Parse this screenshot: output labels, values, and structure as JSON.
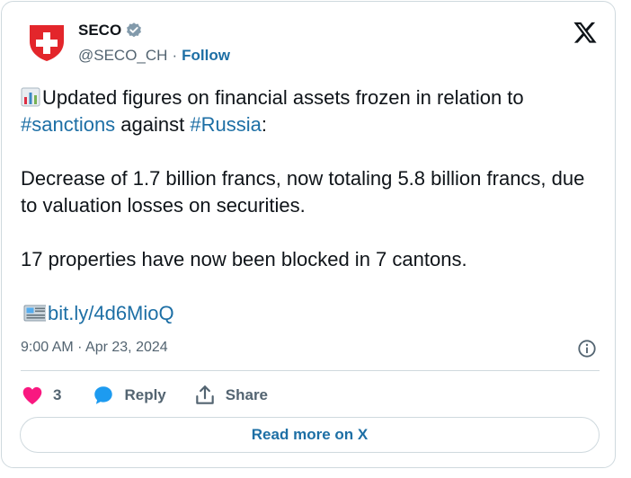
{
  "account": {
    "name": "SECO",
    "handle": "@SECO_CH",
    "separator": "·",
    "follow_label": "Follow"
  },
  "tweet": {
    "line1_text": "Updated figures on financial assets frozen in relation to",
    "hashtag_sanctions": "#sanctions",
    "against_text": " against ",
    "hashtag_russia": "#Russia",
    "colon": ":",
    "paragraph2": "Decrease of 1.7 billion francs, now totaling 5.8 billion francs, due to valuation losses on securities.",
    "paragraph3": "17 properties have now been blocked in 7 cantons.",
    "link_text": "bit.ly/4d6MioQ",
    "emoji_chart": "bar-chart-emoji",
    "emoji_newspaper": "newspaper-emoji"
  },
  "meta": {
    "timestamp": "9:00 AM · Apr 23, 2024"
  },
  "actions": {
    "like_count": "3",
    "reply_label": "Reply",
    "share_label": "Share"
  },
  "footer": {
    "read_more_label": "Read more on X"
  },
  "colors": {
    "link": "#1d6fa5",
    "secondary_text": "#536471",
    "heart": "#f91880",
    "reply_bubble": "#1d9bf0",
    "swiss_red": "#e3262b",
    "border": "#cfd9de"
  }
}
